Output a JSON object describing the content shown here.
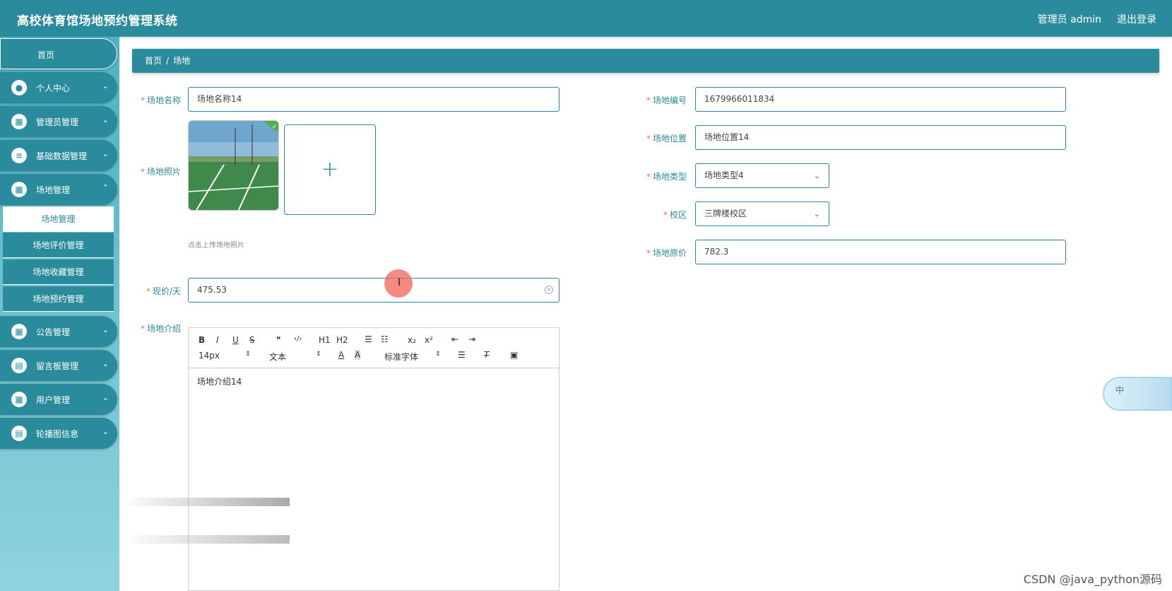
{
  "header": {
    "title": "高校体育馆场地预约管理系统",
    "user": "管理员 admin",
    "logout": "退出登录"
  },
  "sidebar": {
    "home": "首页",
    "items": [
      {
        "label": "个人中心",
        "icon": "person-icon"
      },
      {
        "label": "管理员管理",
        "icon": "grid-icon"
      },
      {
        "label": "基础数据管理",
        "icon": "list-icon"
      },
      {
        "label": "场地管理",
        "icon": "grid-icon"
      },
      {
        "label": "公告管理",
        "icon": "grid-icon"
      },
      {
        "label": "留言板管理",
        "icon": "clipboard-icon"
      },
      {
        "label": "用户管理",
        "icon": "grid-icon"
      },
      {
        "label": "轮播图信息",
        "icon": "clipboard-icon"
      }
    ],
    "subitems": [
      "场地管理",
      "场地评价管理",
      "场地收藏管理",
      "场地预约管理"
    ],
    "active_sub": "场地管理"
  },
  "breadcrumb": {
    "home": "首页",
    "sep": "/",
    "current": "场地"
  },
  "form": {
    "name_label": "场地名称",
    "name_value": "场地名称14",
    "photo_label": "场地照片",
    "upload_tip": "点击上传场地照片",
    "upload_plus": "+",
    "price_label": "现价/天",
    "price_value": "475.53",
    "intro_label": "场地介绍",
    "code_label": "场地编号",
    "code_value": "1679966011834",
    "location_label": "场地位置",
    "location_value": "场地位置14",
    "type_label": "场地类型",
    "type_value": "场地类型4",
    "campus_label": "校区",
    "campus_value": "三牌楼校区",
    "orig_price_label": "场地原价",
    "orig_price_value": "782.3"
  },
  "editor": {
    "font_size": "14px",
    "text_style": "文本",
    "font_family": "标准字体",
    "content": "场地介绍14",
    "buttons": [
      "B",
      "I",
      "U",
      "S",
      "❞",
      "‹/›",
      "H1",
      "H2",
      "☰",
      "☷",
      "x₂",
      "x²",
      "⇤",
      "⇥"
    ]
  },
  "widget": {
    "label": "中"
  },
  "watermark": "CSDN @java_python源码",
  "colors": {
    "primary": "#2a8b9c",
    "required": "#f56c6c"
  }
}
